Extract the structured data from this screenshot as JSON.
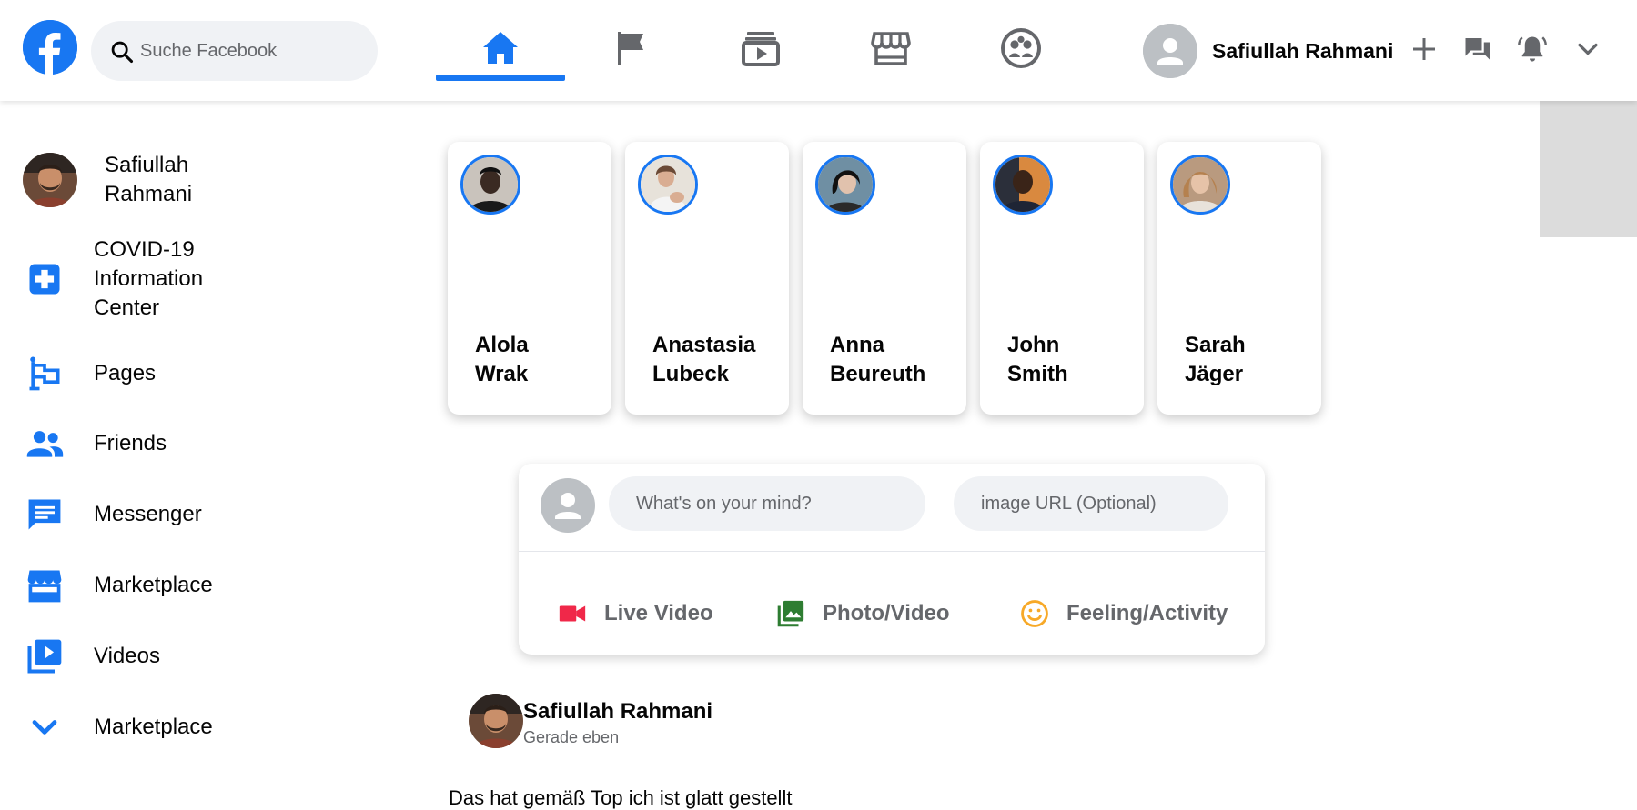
{
  "header": {
    "search_placeholder": "Suche Facebook",
    "nav_tabs": [
      {
        "name": "home",
        "active": true
      },
      {
        "name": "pages",
        "active": false
      },
      {
        "name": "watch",
        "active": false
      },
      {
        "name": "marketplace",
        "active": false
      },
      {
        "name": "groups",
        "active": false
      }
    ],
    "profile_name": "Safiullah Rahmani",
    "accent_color": "#1877f2"
  },
  "sidebar": {
    "profile_name": "Safiullah Rahmani",
    "items": [
      {
        "label": "COVID-19 Information Center",
        "icon": "plus-square-icon"
      },
      {
        "label": "Pages",
        "icon": "flag-icon"
      },
      {
        "label": "Friends",
        "icon": "friends-icon"
      },
      {
        "label": "Messenger",
        "icon": "message-icon"
      },
      {
        "label": "Marketplace",
        "icon": "store-icon"
      },
      {
        "label": "Videos",
        "icon": "video-library-icon"
      },
      {
        "label": "Marketplace",
        "icon": "chevron-down-icon"
      }
    ]
  },
  "stories": [
    {
      "name": "Alola Wrak"
    },
    {
      "name": "Anastasia Lubeck"
    },
    {
      "name": "Anna Beureuth"
    },
    {
      "name": "John Smith"
    },
    {
      "name": "Sarah Jäger"
    }
  ],
  "composer": {
    "text_placeholder": "What's on your mind?",
    "image_placeholder": "image URL (Optional)",
    "actions": [
      {
        "label": "Live Video",
        "icon": "videocam-icon",
        "color": "#f02849"
      },
      {
        "label": "Photo/Video",
        "icon": "photo-library-icon",
        "color": "#45bd62"
      },
      {
        "label": "Feeling/Activity",
        "icon": "smile-icon",
        "color": "#f7b928"
      }
    ]
  },
  "post": {
    "author": "Safiullah Rahmani",
    "time": "Gerade eben",
    "text": "Das hat gemäß Top ich ist glatt gestellt"
  }
}
